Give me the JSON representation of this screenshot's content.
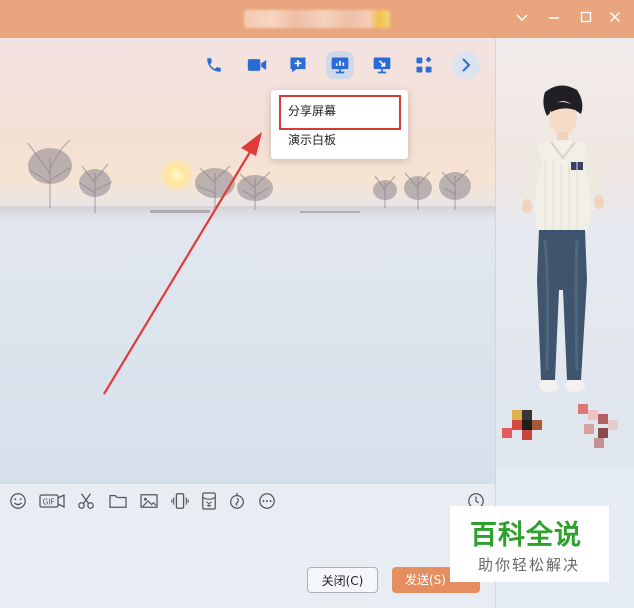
{
  "window": {
    "controls": {
      "minimize_glyph": "—",
      "maximize_glyph": "☐",
      "close_glyph": "✕",
      "collapse_glyph": "∨"
    }
  },
  "toolbar": {
    "icons": [
      "phone-icon",
      "video-call-icon",
      "add-chat-icon",
      "screen-share-icon",
      "remote-desktop-icon",
      "apps-icon",
      "chevron-right-icon"
    ],
    "active_icon": "screen-share-icon",
    "accent_color": "#2b6bd6"
  },
  "share_menu": {
    "items": [
      {
        "label": "分享屏幕"
      },
      {
        "label": "演示白板"
      }
    ],
    "highlight_color": "#d83a3a"
  },
  "compose": {
    "tool_icons": [
      "emoji-icon",
      "gif-icon",
      "scissors-icon",
      "folder-icon",
      "image-icon",
      "shake-icon",
      "red-packet-icon",
      "voice-icon",
      "more-icon",
      "history-clock-icon"
    ],
    "close_label": "关闭(C)",
    "send_label": "发送(S)",
    "send_color": "#e58e60"
  },
  "watermark": {
    "main": "百科全说",
    "sub": "助你轻松解决",
    "color": "#2fa02c"
  },
  "colors": {
    "titlebar": "#e8a57e",
    "annotation_arrow": "#e23a3a"
  }
}
